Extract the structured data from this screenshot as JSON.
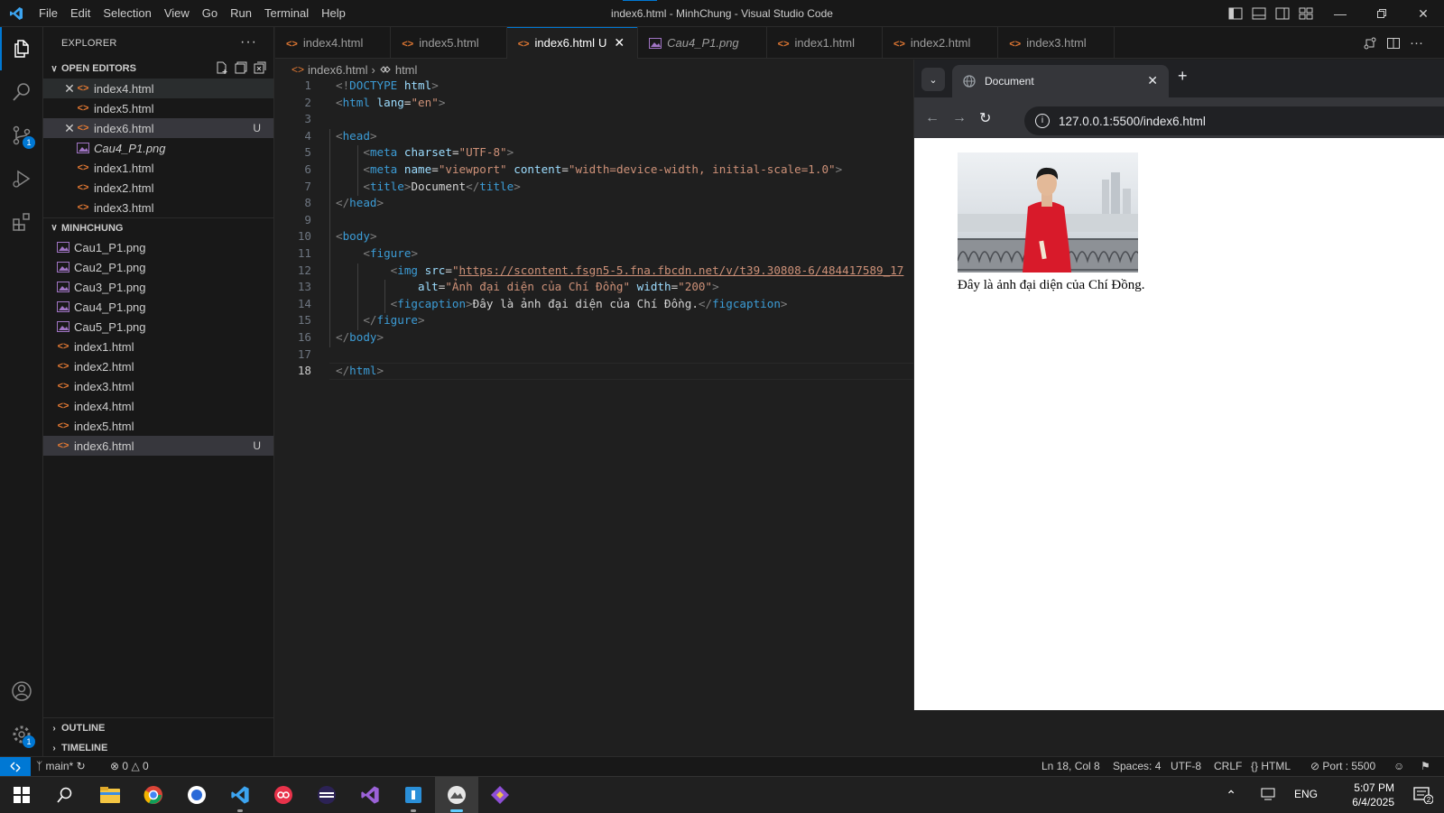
{
  "titlebar": {
    "menu": [
      "File",
      "Edit",
      "Selection",
      "View",
      "Go",
      "Run",
      "Terminal",
      "Help"
    ],
    "window_title": "index6.html - MinhChung - Visual Studio Code"
  },
  "sidebar": {
    "title": "EXPLORER",
    "open_editors_label": "OPEN EDITORS",
    "open_editors": [
      {
        "name": "index4.html",
        "icon": "html-icon",
        "close": true,
        "status": ""
      },
      {
        "name": "index5.html",
        "icon": "html-icon",
        "close": false,
        "status": ""
      },
      {
        "name": "index6.html",
        "icon": "html-icon",
        "close": true,
        "status": "U"
      },
      {
        "name": "Cau4_P1.png",
        "icon": "image-icon",
        "close": false,
        "status": "",
        "italic": true
      },
      {
        "name": "index1.html",
        "icon": "html-icon",
        "close": false,
        "status": ""
      },
      {
        "name": "index2.html",
        "icon": "html-icon",
        "close": false,
        "status": ""
      },
      {
        "name": "index3.html",
        "icon": "html-icon",
        "close": false,
        "status": ""
      }
    ],
    "folder_label": "MINHCHUNG",
    "files": [
      {
        "name": "Cau1_P1.png",
        "icon": "image-icon"
      },
      {
        "name": "Cau2_P1.png",
        "icon": "image-icon"
      },
      {
        "name": "Cau3_P1.png",
        "icon": "image-icon"
      },
      {
        "name": "Cau4_P1.png",
        "icon": "image-icon"
      },
      {
        "name": "Cau5_P1.png",
        "icon": "image-icon"
      },
      {
        "name": "index1.html",
        "icon": "html-icon"
      },
      {
        "name": "index2.html",
        "icon": "html-icon"
      },
      {
        "name": "index3.html",
        "icon": "html-icon"
      },
      {
        "name": "index4.html",
        "icon": "html-icon"
      },
      {
        "name": "index5.html",
        "icon": "html-icon"
      },
      {
        "name": "index6.html",
        "icon": "html-icon",
        "status": "U"
      }
    ],
    "outline_label": "OUTLINE",
    "timeline_label": "TIMELINE"
  },
  "tabs": [
    {
      "name": "index4.html",
      "icon": "html-icon"
    },
    {
      "name": "index5.html",
      "icon": "html-icon"
    },
    {
      "name": "index6.html",
      "icon": "html-icon",
      "active": true,
      "status": "U"
    },
    {
      "name": "Cau4_P1.png",
      "icon": "image-icon",
      "italic": true
    },
    {
      "name": "index1.html",
      "icon": "html-icon"
    },
    {
      "name": "index2.html",
      "icon": "html-icon"
    },
    {
      "name": "index3.html",
      "icon": "html-icon"
    }
  ],
  "breadcrumb": [
    "index6.html",
    "html"
  ],
  "code": {
    "current_line": 18,
    "lines": [
      [
        [
          "tgp",
          "<!"
        ],
        [
          "tg",
          "DOCTYPE"
        ],
        [
          "tx2",
          " "
        ],
        [
          "at",
          "html"
        ],
        [
          "tgp",
          ">"
        ]
      ],
      [
        [
          "tgp",
          "<"
        ],
        [
          "tg",
          "html"
        ],
        [
          "tx2",
          " "
        ],
        [
          "at",
          "lang"
        ],
        [
          "tx2",
          "="
        ],
        [
          "st",
          "\"en\""
        ],
        [
          "tgp",
          ">"
        ]
      ],
      [],
      [
        [
          "tgp",
          "<"
        ],
        [
          "tg",
          "head"
        ],
        [
          "tgp",
          ">"
        ]
      ],
      [
        [
          "tx2",
          "    "
        ],
        [
          "tgp",
          "<"
        ],
        [
          "tg",
          "meta"
        ],
        [
          "tx2",
          " "
        ],
        [
          "at",
          "charset"
        ],
        [
          "tx2",
          "="
        ],
        [
          "st",
          "\"UTF-8\""
        ],
        [
          "tgp",
          ">"
        ]
      ],
      [
        [
          "tx2",
          "    "
        ],
        [
          "tgp",
          "<"
        ],
        [
          "tg",
          "meta"
        ],
        [
          "tx2",
          " "
        ],
        [
          "at",
          "name"
        ],
        [
          "tx2",
          "="
        ],
        [
          "st",
          "\"viewport\""
        ],
        [
          "tx2",
          " "
        ],
        [
          "at",
          "content"
        ],
        [
          "tx2",
          "="
        ],
        [
          "st",
          "\"width=device-width, initial-scale=1.0\""
        ],
        [
          "tgp",
          ">"
        ]
      ],
      [
        [
          "tx2",
          "    "
        ],
        [
          "tgp",
          "<"
        ],
        [
          "tg",
          "title"
        ],
        [
          "tgp",
          ">"
        ],
        [
          "tx2",
          "Document"
        ],
        [
          "tgp",
          "</"
        ],
        [
          "tg",
          "title"
        ],
        [
          "tgp",
          ">"
        ]
      ],
      [
        [
          "tgp",
          "</"
        ],
        [
          "tg",
          "head"
        ],
        [
          "tgp",
          ">"
        ]
      ],
      [],
      [
        [
          "tgp",
          "<"
        ],
        [
          "tg",
          "body"
        ],
        [
          "tgp",
          ">"
        ]
      ],
      [
        [
          "tx2",
          "    "
        ],
        [
          "tgp",
          "<"
        ],
        [
          "tg",
          "figure"
        ],
        [
          "tgp",
          ">"
        ]
      ],
      [
        [
          "tx2",
          "        "
        ],
        [
          "tgp",
          "<"
        ],
        [
          "tg",
          "img"
        ],
        [
          "tx2",
          " "
        ],
        [
          "at",
          "src"
        ],
        [
          "tx2",
          "="
        ],
        [
          "st",
          "\""
        ],
        [
          "sturl",
          "https://scontent.fsgn5-5.fna.fbcdn.net/v/t39.30808-6/484417589_17"
        ]
      ],
      [
        [
          "tx2",
          "            "
        ],
        [
          "at",
          "alt"
        ],
        [
          "tx2",
          "="
        ],
        [
          "st",
          "\"Ảnh đại diện của Chí Đồng\""
        ],
        [
          "tx2",
          " "
        ],
        [
          "at",
          "width"
        ],
        [
          "tx2",
          "="
        ],
        [
          "st",
          "\"200\""
        ],
        [
          "tgp",
          ">"
        ]
      ],
      [
        [
          "tx2",
          "        "
        ],
        [
          "tgp",
          "<"
        ],
        [
          "tg",
          "figcaption"
        ],
        [
          "tgp",
          ">"
        ],
        [
          "tx2",
          "Đây là ảnh đại diện của Chí Đồng."
        ],
        [
          "tgp",
          "</"
        ],
        [
          "tg",
          "figcaption"
        ],
        [
          "tgp",
          ">"
        ]
      ],
      [
        [
          "tx2",
          "    "
        ],
        [
          "tgp",
          "</"
        ],
        [
          "tg",
          "figure"
        ],
        [
          "tgp",
          ">"
        ]
      ],
      [
        [
          "tgp",
          "</"
        ],
        [
          "tg",
          "body"
        ],
        [
          "tgp",
          ">"
        ]
      ],
      [],
      [
        [
          "tgp",
          "</"
        ],
        [
          "tg",
          "html"
        ],
        [
          "tgp",
          ">"
        ]
      ]
    ]
  },
  "browser": {
    "tab_title": "Document",
    "url": "127.0.0.1:5500/index6.html",
    "caption": "Đây là ảnh đại diện của Chí Đồng."
  },
  "statusbar": {
    "branch": "main*",
    "errors": "0",
    "warnings": "0",
    "position": "Ln 18, Col 8",
    "spaces": "Spaces: 4",
    "encoding": "UTF-8",
    "eol": "CRLF",
    "language": "HTML",
    "port": "Port : 5500"
  },
  "tray": {
    "lang": "ENG",
    "time": "5:07 PM",
    "date": "6/4/2025",
    "notif_count": "2"
  },
  "colors": {
    "accent": "#0078d4",
    "html_icon": "#e37933",
    "image_icon": "#a074c4"
  }
}
